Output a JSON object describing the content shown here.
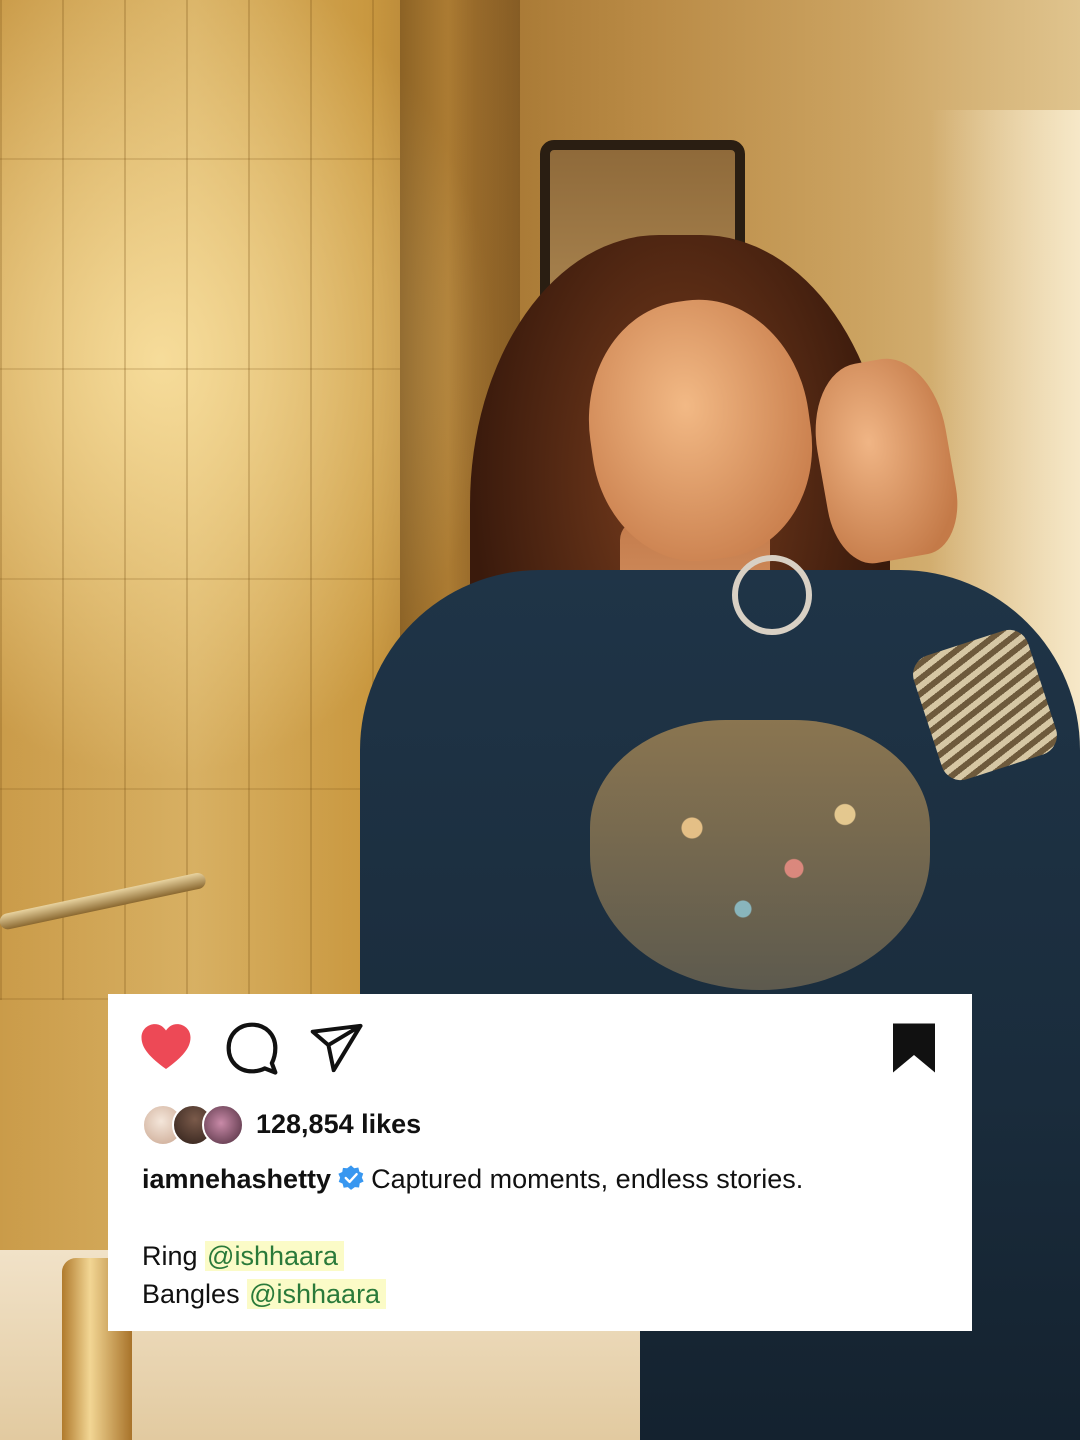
{
  "post": {
    "likes_text": "128,854 likes",
    "username": "iamnehashetty",
    "caption": "Captured moments, endless stories.",
    "credits": [
      {
        "label": "Ring",
        "mention": "@ishhaara"
      },
      {
        "label": "Bangles",
        "mention": "@ishhaara"
      }
    ],
    "liked": true,
    "saved": true
  },
  "icons": {
    "like": "heart-icon",
    "comment": "comment-icon",
    "share": "send-icon",
    "save": "bookmark-icon",
    "verified": "verified-badge-icon"
  },
  "colors": {
    "heart": "#ed4956",
    "verified": "#3897f0",
    "mention_highlight": "#fbfbc7",
    "mention_text": "#2a7a3a"
  }
}
